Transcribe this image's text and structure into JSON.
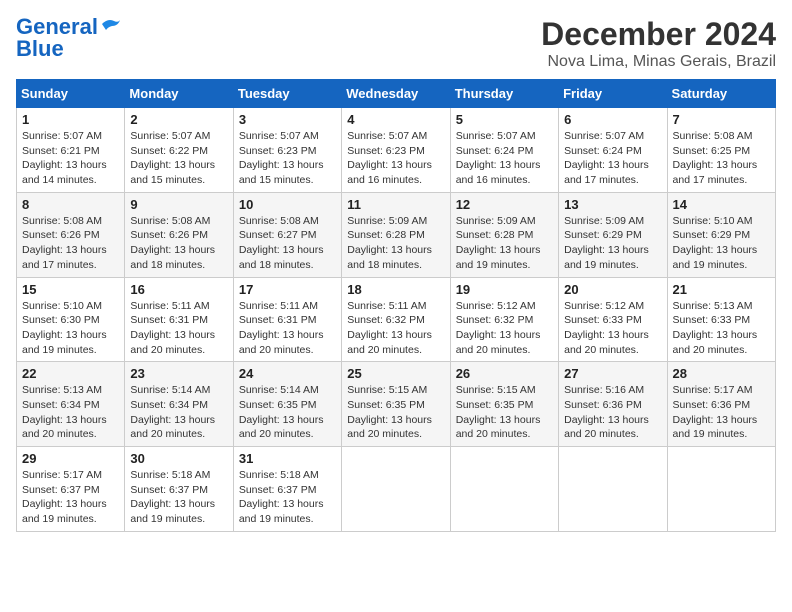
{
  "header": {
    "logo_line1": "General",
    "logo_line2": "Blue",
    "month": "December 2024",
    "location": "Nova Lima, Minas Gerais, Brazil"
  },
  "weekdays": [
    "Sunday",
    "Monday",
    "Tuesday",
    "Wednesday",
    "Thursday",
    "Friday",
    "Saturday"
  ],
  "weeks": [
    [
      {
        "day": "1",
        "sunrise": "5:07 AM",
        "sunset": "6:21 PM",
        "daylight": "13 hours and 14 minutes."
      },
      {
        "day": "2",
        "sunrise": "5:07 AM",
        "sunset": "6:22 PM",
        "daylight": "13 hours and 15 minutes."
      },
      {
        "day": "3",
        "sunrise": "5:07 AM",
        "sunset": "6:23 PM",
        "daylight": "13 hours and 15 minutes."
      },
      {
        "day": "4",
        "sunrise": "5:07 AM",
        "sunset": "6:23 PM",
        "daylight": "13 hours and 16 minutes."
      },
      {
        "day": "5",
        "sunrise": "5:07 AM",
        "sunset": "6:24 PM",
        "daylight": "13 hours and 16 minutes."
      },
      {
        "day": "6",
        "sunrise": "5:07 AM",
        "sunset": "6:24 PM",
        "daylight": "13 hours and 17 minutes."
      },
      {
        "day": "7",
        "sunrise": "5:08 AM",
        "sunset": "6:25 PM",
        "daylight": "13 hours and 17 minutes."
      }
    ],
    [
      {
        "day": "8",
        "sunrise": "5:08 AM",
        "sunset": "6:26 PM",
        "daylight": "13 hours and 17 minutes."
      },
      {
        "day": "9",
        "sunrise": "5:08 AM",
        "sunset": "6:26 PM",
        "daylight": "13 hours and 18 minutes."
      },
      {
        "day": "10",
        "sunrise": "5:08 AM",
        "sunset": "6:27 PM",
        "daylight": "13 hours and 18 minutes."
      },
      {
        "day": "11",
        "sunrise": "5:09 AM",
        "sunset": "6:28 PM",
        "daylight": "13 hours and 18 minutes."
      },
      {
        "day": "12",
        "sunrise": "5:09 AM",
        "sunset": "6:28 PM",
        "daylight": "13 hours and 19 minutes."
      },
      {
        "day": "13",
        "sunrise": "5:09 AM",
        "sunset": "6:29 PM",
        "daylight": "13 hours and 19 minutes."
      },
      {
        "day": "14",
        "sunrise": "5:10 AM",
        "sunset": "6:29 PM",
        "daylight": "13 hours and 19 minutes."
      }
    ],
    [
      {
        "day": "15",
        "sunrise": "5:10 AM",
        "sunset": "6:30 PM",
        "daylight": "13 hours and 19 minutes."
      },
      {
        "day": "16",
        "sunrise": "5:11 AM",
        "sunset": "6:31 PM",
        "daylight": "13 hours and 20 minutes."
      },
      {
        "day": "17",
        "sunrise": "5:11 AM",
        "sunset": "6:31 PM",
        "daylight": "13 hours and 20 minutes."
      },
      {
        "day": "18",
        "sunrise": "5:11 AM",
        "sunset": "6:32 PM",
        "daylight": "13 hours and 20 minutes."
      },
      {
        "day": "19",
        "sunrise": "5:12 AM",
        "sunset": "6:32 PM",
        "daylight": "13 hours and 20 minutes."
      },
      {
        "day": "20",
        "sunrise": "5:12 AM",
        "sunset": "6:33 PM",
        "daylight": "13 hours and 20 minutes."
      },
      {
        "day": "21",
        "sunrise": "5:13 AM",
        "sunset": "6:33 PM",
        "daylight": "13 hours and 20 minutes."
      }
    ],
    [
      {
        "day": "22",
        "sunrise": "5:13 AM",
        "sunset": "6:34 PM",
        "daylight": "13 hours and 20 minutes."
      },
      {
        "day": "23",
        "sunrise": "5:14 AM",
        "sunset": "6:34 PM",
        "daylight": "13 hours and 20 minutes."
      },
      {
        "day": "24",
        "sunrise": "5:14 AM",
        "sunset": "6:35 PM",
        "daylight": "13 hours and 20 minutes."
      },
      {
        "day": "25",
        "sunrise": "5:15 AM",
        "sunset": "6:35 PM",
        "daylight": "13 hours and 20 minutes."
      },
      {
        "day": "26",
        "sunrise": "5:15 AM",
        "sunset": "6:35 PM",
        "daylight": "13 hours and 20 minutes."
      },
      {
        "day": "27",
        "sunrise": "5:16 AM",
        "sunset": "6:36 PM",
        "daylight": "13 hours and 20 minutes."
      },
      {
        "day": "28",
        "sunrise": "5:17 AM",
        "sunset": "6:36 PM",
        "daylight": "13 hours and 19 minutes."
      }
    ],
    [
      {
        "day": "29",
        "sunrise": "5:17 AM",
        "sunset": "6:37 PM",
        "daylight": "13 hours and 19 minutes."
      },
      {
        "day": "30",
        "sunrise": "5:18 AM",
        "sunset": "6:37 PM",
        "daylight": "13 hours and 19 minutes."
      },
      {
        "day": "31",
        "sunrise": "5:18 AM",
        "sunset": "6:37 PM",
        "daylight": "13 hours and 19 minutes."
      },
      null,
      null,
      null,
      null
    ]
  ],
  "labels": {
    "sunrise_prefix": "Sunrise: ",
    "sunset_prefix": "Sunset: ",
    "daylight_prefix": "Daylight: "
  }
}
